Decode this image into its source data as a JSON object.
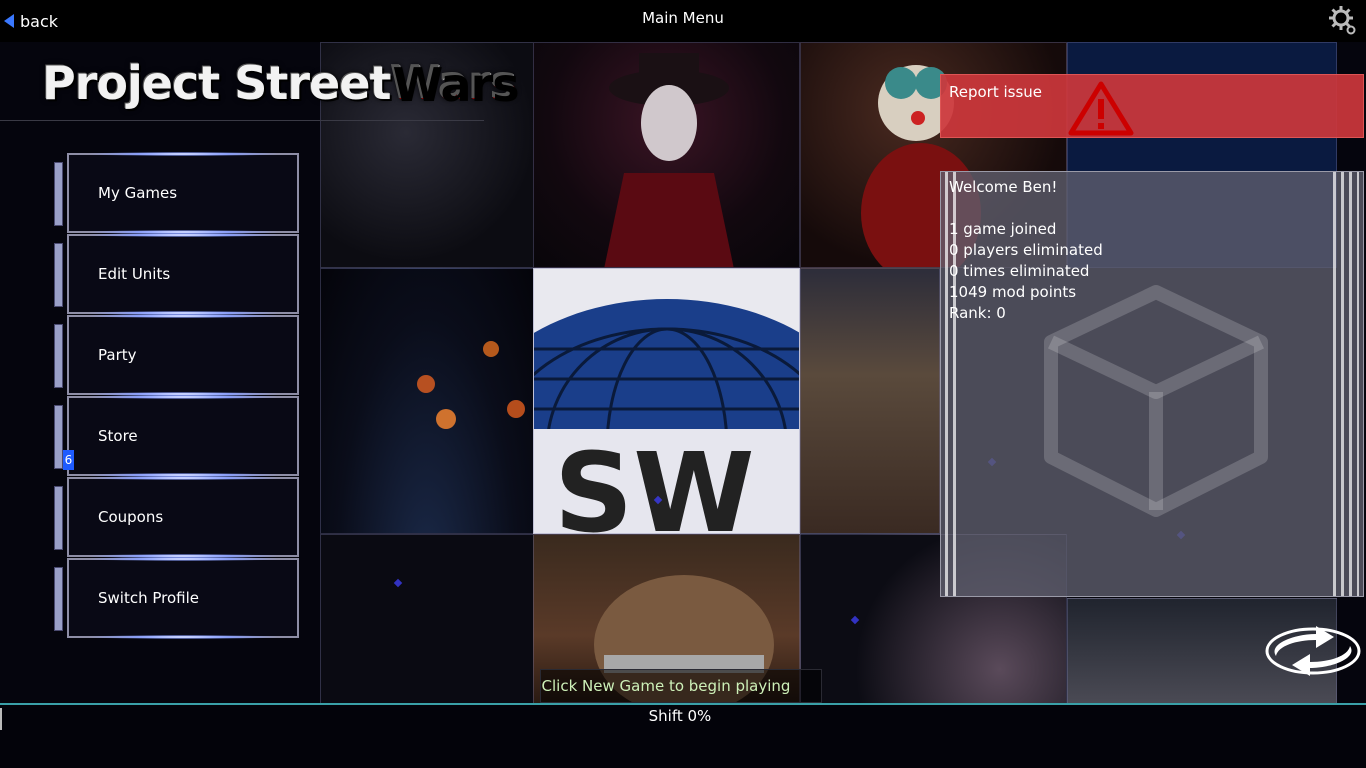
{
  "topbar": {
    "back_label": "back",
    "title": "Main Menu",
    "settings_icon": "gear-icon"
  },
  "logo": {
    "part1": "Project Street",
    "part2": "Wars"
  },
  "menu": {
    "items": [
      {
        "label": "My Games"
      },
      {
        "label": "Edit Units"
      },
      {
        "label": "Party"
      },
      {
        "label": "Store"
      },
      {
        "label": "Coupons"
      },
      {
        "label": "Switch Profile"
      }
    ],
    "store_badge": "6"
  },
  "report": {
    "label": "Report issue",
    "icon": "warning-icon",
    "color": "#cd373c"
  },
  "welcome": {
    "greeting": "Welcome Ben!",
    "stats": [
      "1 game joined",
      "0 players eliminated",
      "0 times eliminated",
      "1049 mod points",
      "Rank: 0"
    ]
  },
  "refresh_icon": "refresh-icon",
  "hint": "Click New Game to begin playing",
  "shift": {
    "label": "Shift 0%",
    "progress": 0
  },
  "colors": {
    "accent": "#3a78ff",
    "bottom_border": "#3aa0a8",
    "hint_text": "#cdf0b8"
  }
}
